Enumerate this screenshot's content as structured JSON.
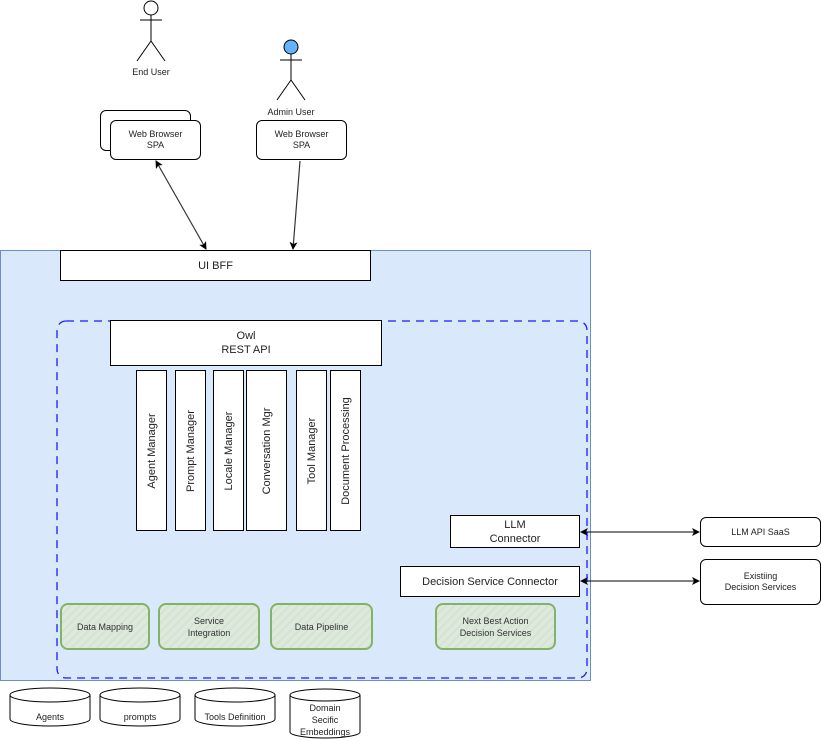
{
  "actors": [
    {
      "label": "End User",
      "head_color": "#ffffff"
    },
    {
      "label": "Admin User",
      "head_color": "#66b2ff"
    }
  ],
  "browsers": [
    {
      "line1": "Web Browser",
      "line2": "SPA",
      "stacked": true
    },
    {
      "line1": "Web Browser",
      "line2": "SPA",
      "stacked": false
    }
  ],
  "system": {
    "ui_bff": "UI BFF",
    "owl_api": {
      "line1": "Owl",
      "line2": "REST API"
    },
    "managers": [
      "Agent Manager",
      "Prompt Manager",
      "Locale Manager",
      "Conversation Mgr",
      "Tool Manager",
      "Document Processing"
    ],
    "connectors": {
      "llm": {
        "line1": "LLM",
        "line2": "Connector"
      },
      "decision": "Decision Service Connector"
    },
    "modules": [
      {
        "line1": "Data Mapping",
        "line2": ""
      },
      {
        "line1": "Service",
        "line2": "Integration"
      },
      {
        "line1": "Data Pipeline",
        "line2": ""
      },
      {
        "line1": "Next Best Action",
        "line2": "Decision Services"
      }
    ],
    "colors": {
      "container_fill": "#dae8fc",
      "container_border": "#6c8ebf",
      "dashed_border": "#0000cc",
      "module_border": "#82b366"
    }
  },
  "external": [
    {
      "line1": "LLM API SaaS",
      "line2": ""
    },
    {
      "line1": "Existiing",
      "line2": "Decision Services"
    }
  ],
  "datastores": [
    {
      "line1": "Agents",
      "line2": "",
      "line3": ""
    },
    {
      "line1": "prompts",
      "line2": "",
      "line3": ""
    },
    {
      "line1": "Tools Definition",
      "line2": "",
      "line3": ""
    },
    {
      "line1": "Domain",
      "line2": "Secific",
      "line3": "Embeddings"
    }
  ]
}
